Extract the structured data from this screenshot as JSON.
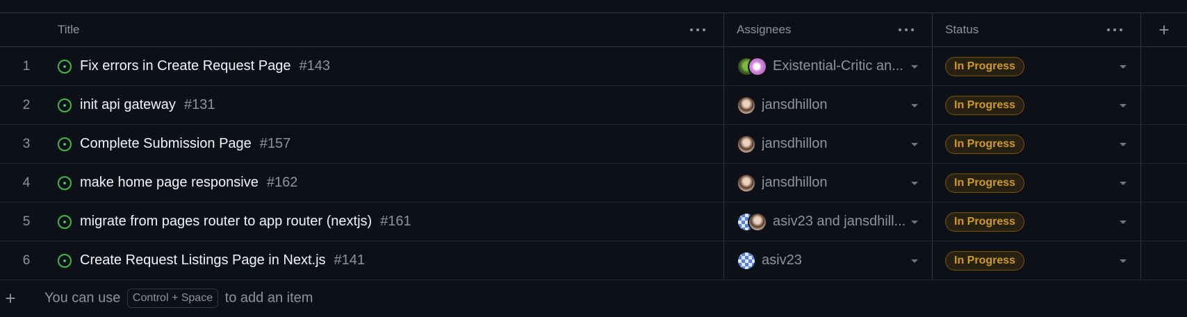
{
  "columns": {
    "title": "Title",
    "assignees": "Assignees",
    "status": "Status"
  },
  "rows": [
    {
      "num": "1",
      "title": "Fix errors in Create Request Page",
      "issue": "#143",
      "assignees": "Existential-Critic an...",
      "avatars": [
        "av-ec",
        "av-pink"
      ],
      "status": "In Progress"
    },
    {
      "num": "2",
      "title": "init api gateway",
      "issue": "#131",
      "assignees": "jansdhillon",
      "avatars": [
        "av-jd"
      ],
      "status": "In Progress"
    },
    {
      "num": "3",
      "title": "Complete Submission Page",
      "issue": "#157",
      "assignees": "jansdhillon",
      "avatars": [
        "av-jd"
      ],
      "status": "In Progress"
    },
    {
      "num": "4",
      "title": "make home page responsive",
      "issue": "#162",
      "assignees": "jansdhillon",
      "avatars": [
        "av-jd"
      ],
      "status": "In Progress"
    },
    {
      "num": "5",
      "title": "migrate from pages router to app router (nextjs)",
      "issue": "#161",
      "assignees": "asiv23 and jansdhill...",
      "avatars": [
        "av-as",
        "av-jd"
      ],
      "status": "In Progress"
    },
    {
      "num": "6",
      "title": "Create Request Listings Page in Next.js",
      "issue": "#141",
      "assignees": "asiv23",
      "avatars": [
        "av-as"
      ],
      "status": "In Progress"
    }
  ],
  "footer": {
    "prefix": "You can use",
    "shortcut": "Control + Space",
    "suffix": "to add an item"
  },
  "icons": {
    "add": "plus-icon",
    "menu": "kebab-menu-icon",
    "issue": "open-issue-icon",
    "dropdown": "caret-down-icon"
  },
  "colors": {
    "background": "#0d1117",
    "issue_open": "#3fb950",
    "status_in_progress": "#d29922"
  }
}
